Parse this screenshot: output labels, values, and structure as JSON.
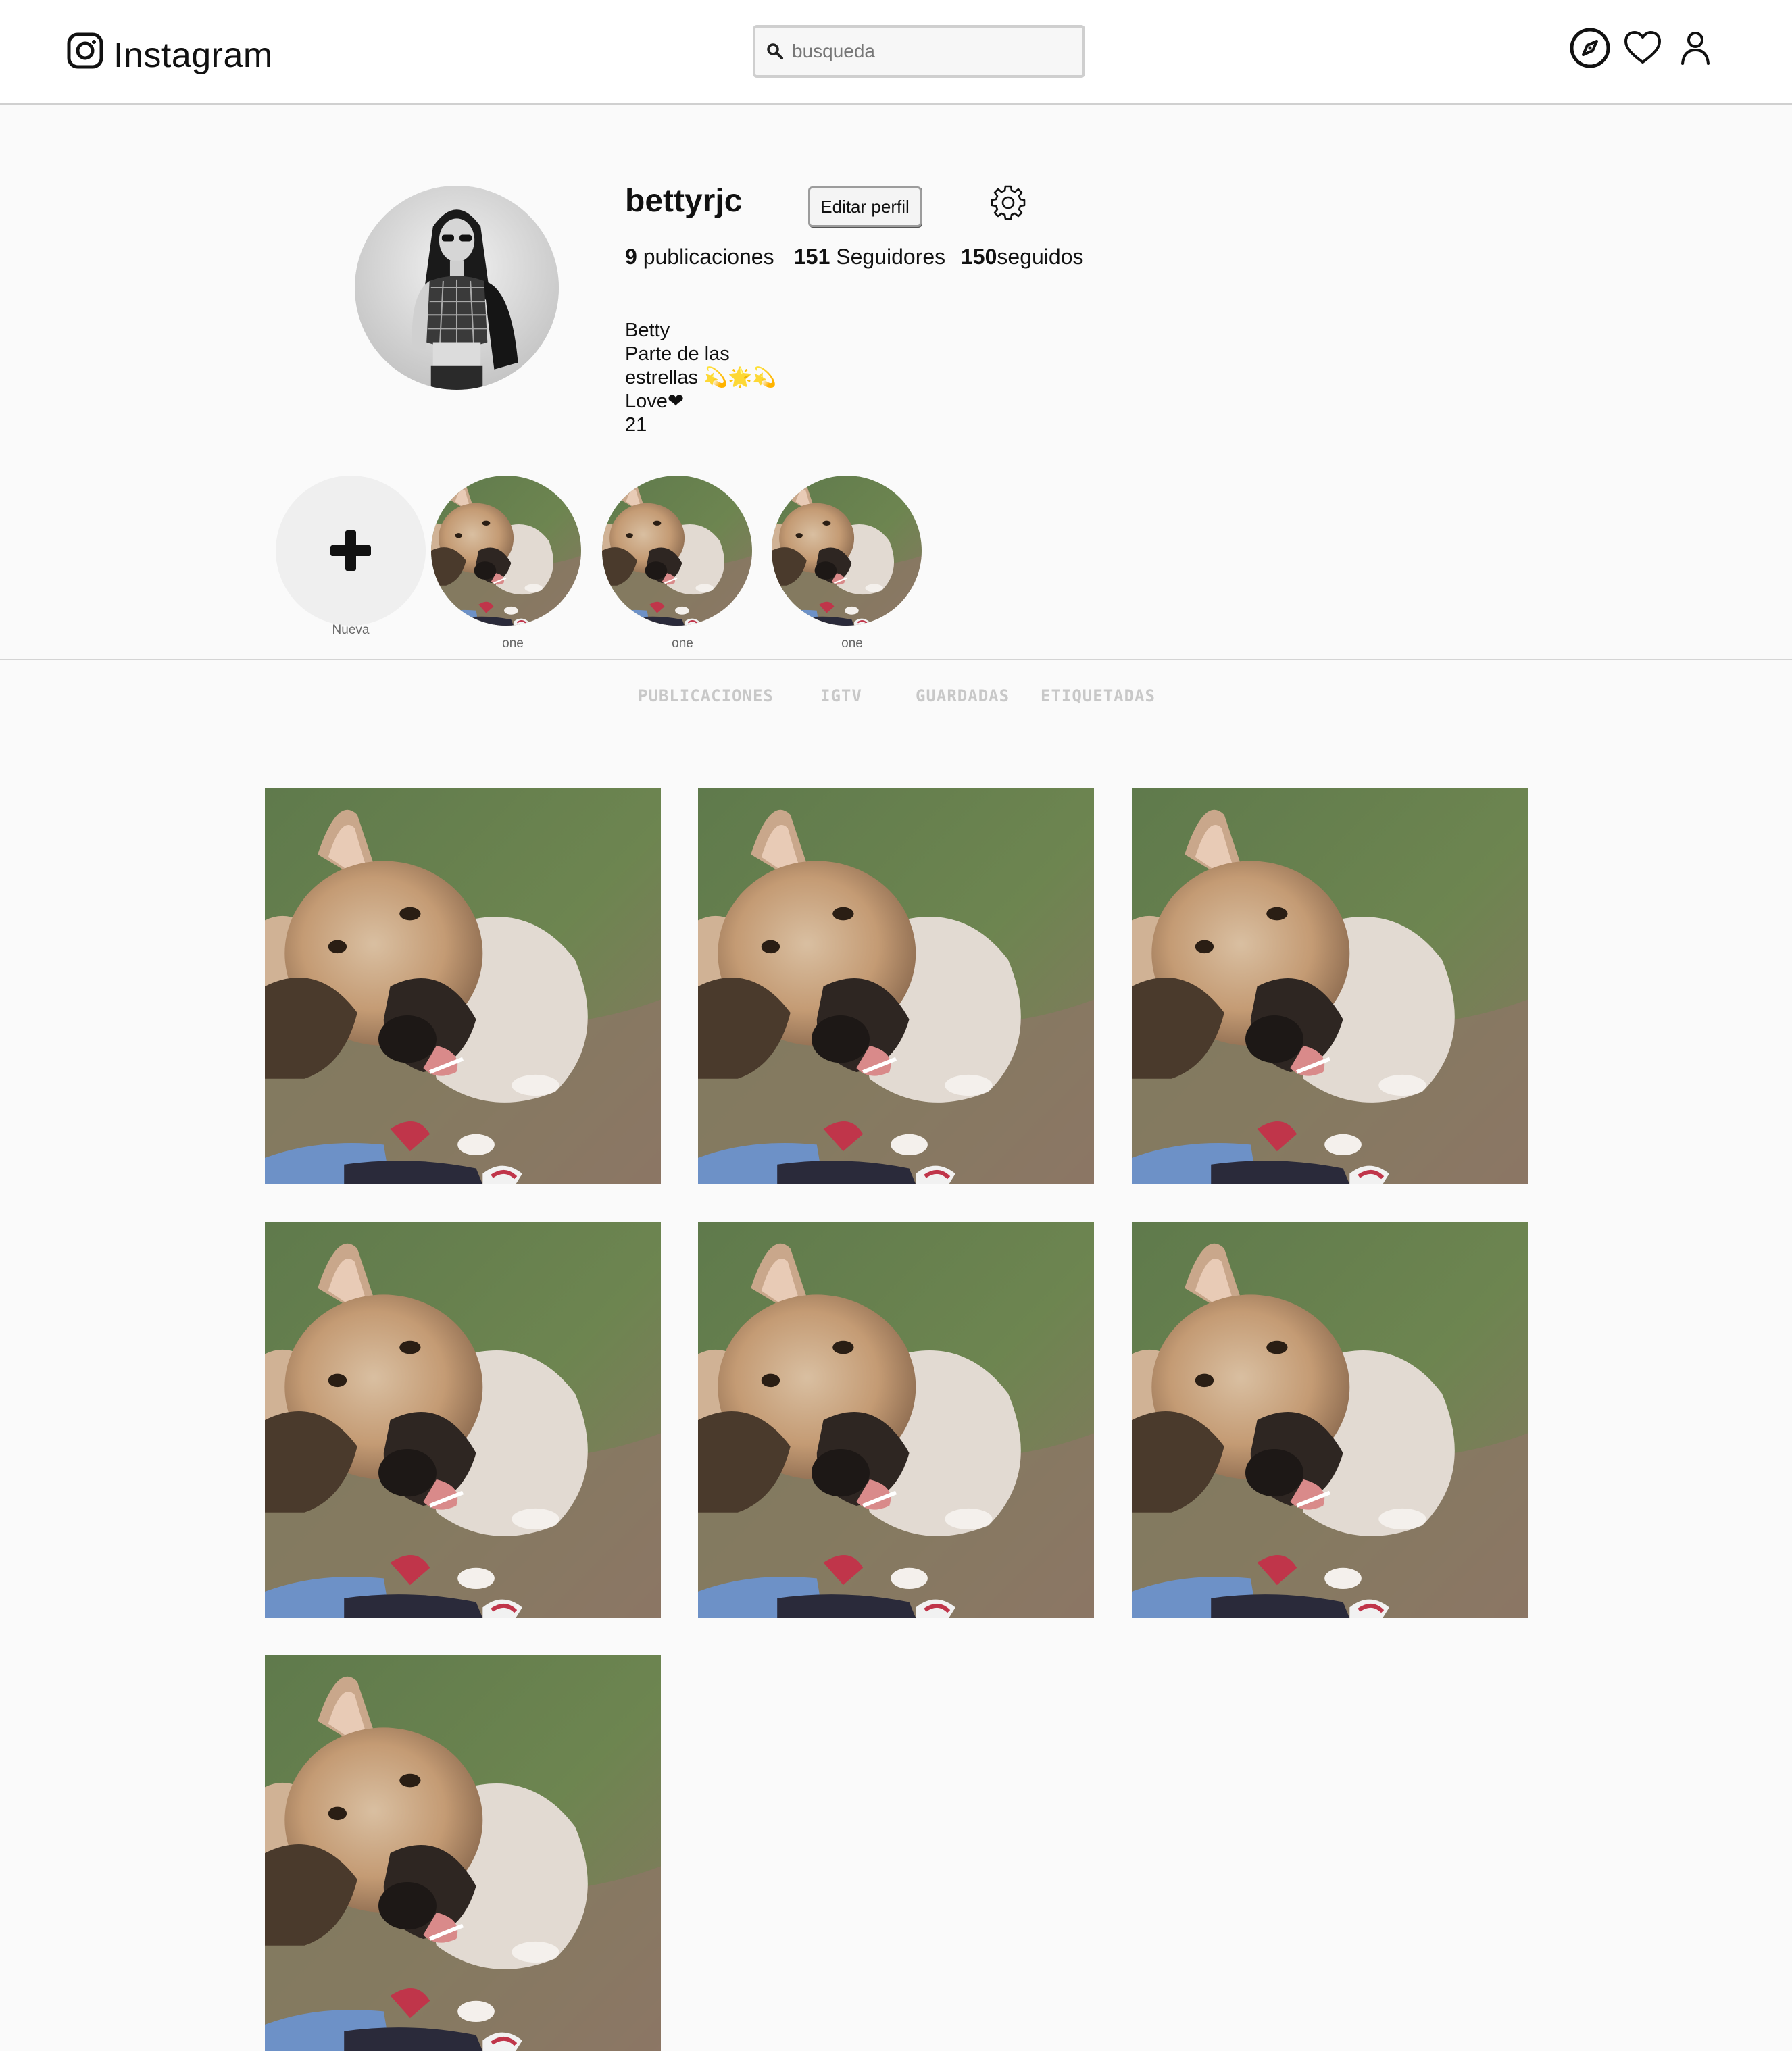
{
  "header": {
    "brand": "Instagram",
    "search_placeholder": "busqueda",
    "icons": [
      "instagram-logo-icon",
      "search-icon",
      "compass-icon",
      "heart-icon",
      "user-icon"
    ]
  },
  "profile": {
    "username": "bettyrjc",
    "edit_label": "Editar perfil",
    "posts_count": "9",
    "posts_label": "publicaciones",
    "followers_count": "151",
    "followers_label": "Seguidores",
    "following_count": "150",
    "following_label": "seguidos",
    "bio": [
      "Betty",
      "Parte de las",
      "estrellas 💫🌟💫",
      "Love❤",
      "21"
    ]
  },
  "highlights": {
    "new_label": "Nueva",
    "items": [
      {
        "label": "one"
      },
      {
        "label": "one"
      },
      {
        "label": "one"
      }
    ]
  },
  "tabs": [
    "PUBLICACIONES",
    "IGTV",
    "GUARDADAS",
    "ETIQUETADAS"
  ],
  "posts": {
    "count_visible": 7,
    "image": "dog-photo"
  },
  "colors": {
    "header_bg": "#ffffff",
    "page_bg": "#fafafa",
    "tab_text": "#c8c8c8",
    "divider": "#d4d4d4"
  }
}
